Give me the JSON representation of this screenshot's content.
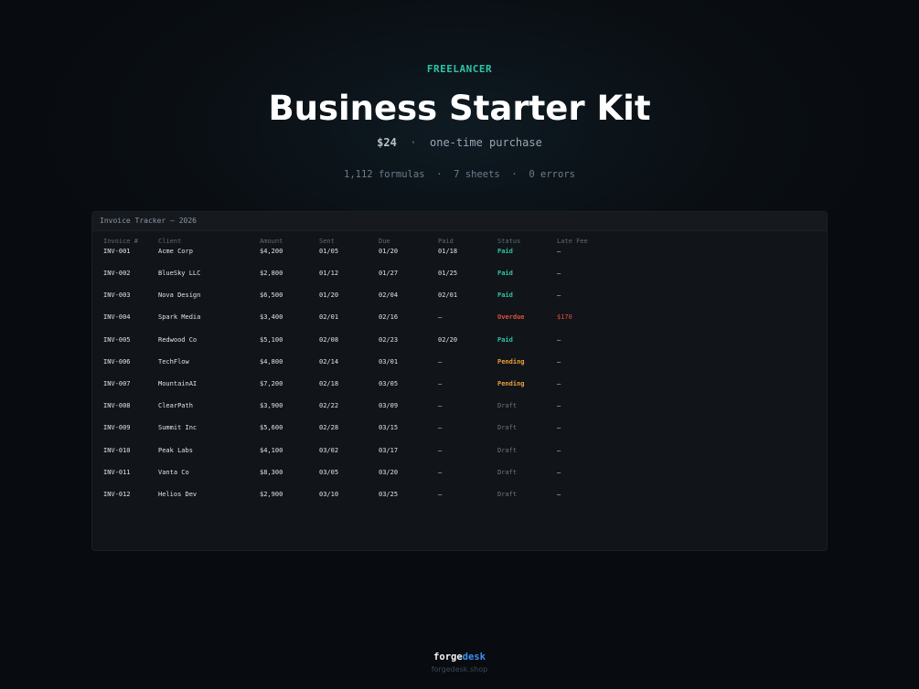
{
  "hero": {
    "eyebrow": "FREELANCER",
    "title": "Business Starter Kit",
    "price": "$24",
    "separator": "·",
    "purchase_type": "one-time purchase",
    "stats": [
      "1,112 formulas",
      "7 sheets",
      "0 errors"
    ]
  },
  "sheet": {
    "title": "Invoice Tracker — 2026",
    "columns": [
      "Invoice #",
      "Client",
      "Amount",
      "Sent",
      "Due",
      "Paid",
      "Status",
      "Late Fee"
    ],
    "rows": [
      [
        "INV-001",
        "Acme Corp",
        "$4,200",
        "01/05",
        "01/20",
        "01/18",
        "Paid",
        "—"
      ],
      [
        "INV-002",
        "BlueSky LLC",
        "$2,800",
        "01/12",
        "01/27",
        "01/25",
        "Paid",
        "—"
      ],
      [
        "INV-003",
        "Nova Design",
        "$6,500",
        "01/20",
        "02/04",
        "02/01",
        "Paid",
        "—"
      ],
      [
        "INV-004",
        "Spark Media",
        "$3,400",
        "02/01",
        "02/16",
        "—",
        "Overdue",
        "$170"
      ],
      [
        "INV-005",
        "Redwood Co",
        "$5,100",
        "02/08",
        "02/23",
        "02/20",
        "Paid",
        "—"
      ],
      [
        "INV-006",
        "TechFlow",
        "$4,800",
        "02/14",
        "03/01",
        "—",
        "Pending",
        "—"
      ],
      [
        "INV-007",
        "MountainAI",
        "$7,200",
        "02/18",
        "03/05",
        "—",
        "Pending",
        "—"
      ],
      [
        "INV-008",
        "ClearPath",
        "$3,900",
        "02/22",
        "03/09",
        "—",
        "Draft",
        "—"
      ],
      [
        "INV-009",
        "Summit Inc",
        "$5,600",
        "02/28",
        "03/15",
        "—",
        "Draft",
        "—"
      ],
      [
        "INV-010",
        "Peak Labs",
        "$4,100",
        "03/02",
        "03/17",
        "—",
        "Draft",
        "—"
      ],
      [
        "INV-011",
        "Vanta Co",
        "$8,300",
        "03/05",
        "03/20",
        "—",
        "Draft",
        "—"
      ],
      [
        "INV-012",
        "Helios Dev",
        "$2,900",
        "03/10",
        "03/25",
        "—",
        "Draft",
        "—"
      ]
    ],
    "status_colors": {
      "Paid": "#2ec4a4",
      "Overdue": "#e0513f",
      "Pending": "#e8a13a",
      "Draft": "#6a7684"
    }
  },
  "footer": {
    "brand_part1": "forge",
    "brand_part2": "desk",
    "url": "forgedesk.shop"
  },
  "colors": {
    "background": "#080b0f",
    "accent_teal": "#2ec4a4",
    "accent_blue": "#3d8ff0"
  }
}
